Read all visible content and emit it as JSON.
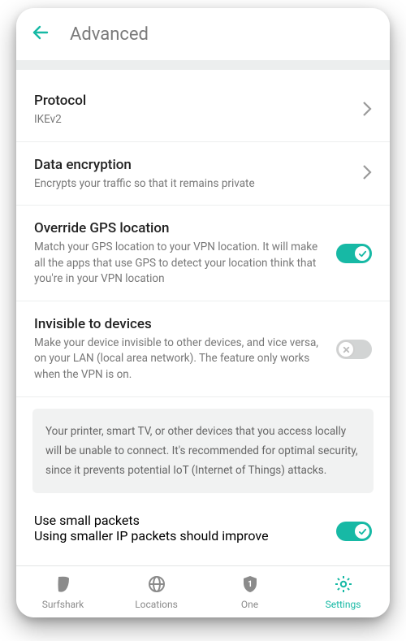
{
  "header": {
    "title": "Advanced"
  },
  "rows": {
    "protocol": {
      "title": "Protocol",
      "sub": "IKEv2"
    },
    "encryption": {
      "title": "Data encryption",
      "sub": "Encrypts your traffic so that it remains private"
    },
    "gps": {
      "title": "Override GPS location",
      "sub": "Match your GPS location to your VPN location. It will make all the apps that use GPS to detect your location think that you're in your VPN location"
    },
    "invisible": {
      "title": "Invisible to devices",
      "sub": "Make your device invisible to other devices, and vice versa, on your LAN (local area network). The feature only works when the VPN is on."
    },
    "info": "Your printer, smart TV, or other devices that you access locally will be unable to connect. It's recommended for optimal security, since it prevents potential IoT (Internet of Things) attacks.",
    "packets": {
      "title": "Use small packets",
      "sub": "Using smaller IP packets should improve compatibility with some routers and mobile"
    }
  },
  "nav": {
    "surfshark": "Surfshark",
    "locations": "Locations",
    "one": "One",
    "settings": "Settings"
  }
}
